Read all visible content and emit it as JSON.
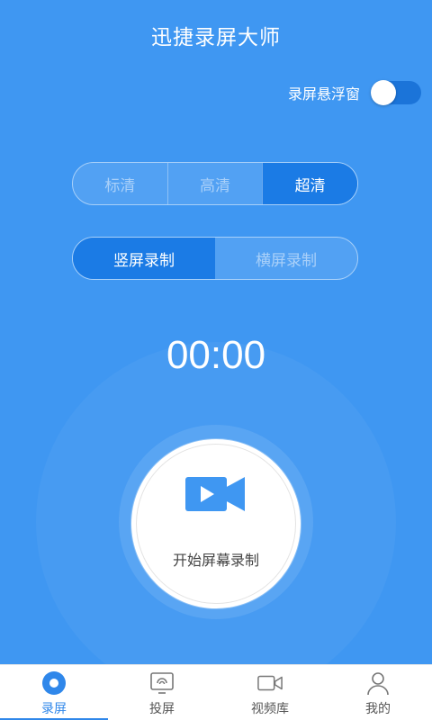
{
  "app_title": "迅捷录屏大师",
  "float_window": {
    "label": "录屏悬浮窗",
    "enabled": true
  },
  "quality_options": [
    {
      "label": "标清",
      "selected": false
    },
    {
      "label": "高清",
      "selected": false
    },
    {
      "label": "超清",
      "selected": true
    }
  ],
  "orientation_options": [
    {
      "label": "竖屏录制",
      "selected": true
    },
    {
      "label": "横屏录制",
      "selected": false
    }
  ],
  "timer": "00:00",
  "record_button": {
    "label": "开始屏幕录制",
    "icon": "video-camera-icon"
  },
  "tabs": [
    {
      "label": "录屏",
      "icon": "record-icon",
      "active": true
    },
    {
      "label": "投屏",
      "icon": "cast-screen-icon",
      "active": false
    },
    {
      "label": "视频库",
      "icon": "video-library-icon",
      "active": false
    },
    {
      "label": "我的",
      "icon": "profile-icon",
      "active": false
    }
  ],
  "colors": {
    "background": "#3f97f2",
    "accent": "#1b7be5",
    "tab_active": "#2f87ea",
    "toggle_track": "#1b74d9"
  }
}
